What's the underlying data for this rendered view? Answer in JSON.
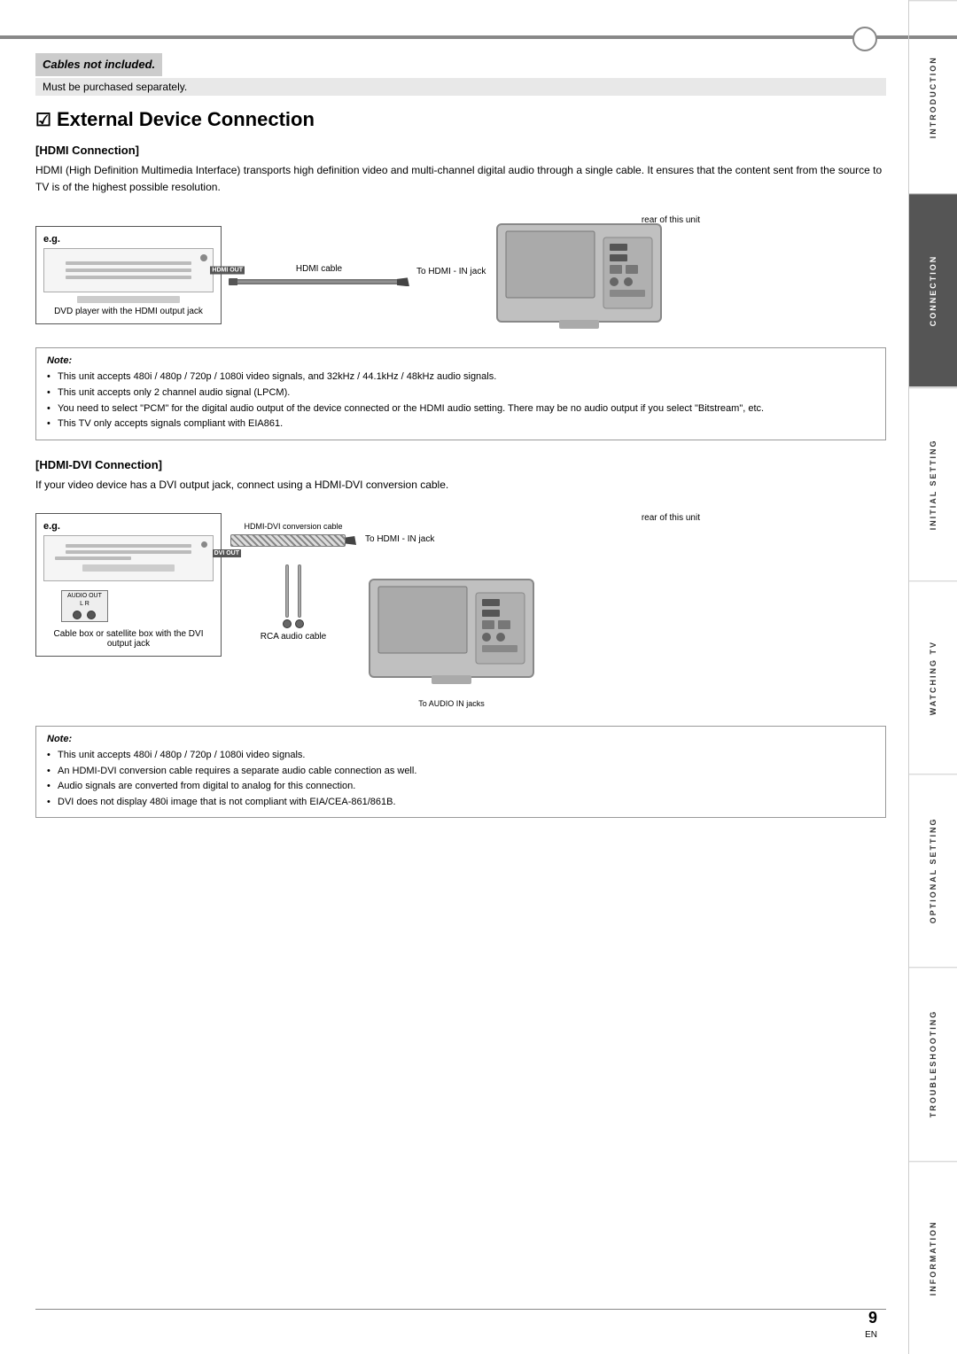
{
  "page": {
    "number": "9",
    "lang": "EN"
  },
  "cables_banner": {
    "bold_text": "Cables not included.",
    "sub_text": "Must be purchased separately."
  },
  "section_title": "External Device Connection",
  "hdmi_section": {
    "heading": "[HDMI Connection]",
    "description": "HDMI (High Definition Multimedia Interface) transports high definition video and multi-channel digital audio through a single cable. It ensures that the content sent from the source to TV is of the highest possible resolution.",
    "rear_label": "rear of this unit",
    "device_label": "DVD player with the HDMI output jack",
    "cable_label": "HDMI cable",
    "port_label": "To HDMI - IN jack",
    "hdmi_out": "HDMI OUT",
    "eg_label": "e.g."
  },
  "hdmi_note": {
    "title": "Note:",
    "items": [
      "This unit accepts 480i / 480p / 720p / 1080i video signals, and 32kHz / 44.1kHz / 48kHz audio signals.",
      "This unit accepts only 2 channel audio signal (LPCM).",
      "You need to select \"PCM\" for the digital audio output of the device connected or the HDMI audio setting. There may be no audio output if you select \"Bitstream\", etc.",
      "This TV only accepts signals compliant with EIA861."
    ]
  },
  "hdmi_dvi_section": {
    "heading": "[HDMI-DVI Connection]",
    "description": "If your video device has a DVI output jack, connect using a HDMI-DVI conversion cable.",
    "rear_label": "rear of this unit",
    "device_label": "Cable box or satellite box with the DVI output jack",
    "conversion_cable_label": "HDMI-DVI conversion cable",
    "port_label": "To HDMI - IN jack",
    "dvi_out": "DVI OUT",
    "audio_out": "AUDIO OUT",
    "lr_label": "L    R",
    "rca_label": "RCA audio cable",
    "to_audio_label": "To AUDIO IN jacks",
    "eg_label": "e.g."
  },
  "hdmi_dvi_note": {
    "title": "Note:",
    "items": [
      "This unit accepts 480i / 480p / 720p / 1080i video signals.",
      "An HDMI-DVI conversion cable requires a separate audio cable connection as well.",
      "Audio signals are converted from digital to analog for this connection.",
      "DVI does not display 480i image that is not compliant with EIA/CEA-861/861B."
    ]
  },
  "sidebar": {
    "tabs": [
      {
        "label": "INTRODUCTION",
        "active": false
      },
      {
        "label": "CONNECTION",
        "active": true
      },
      {
        "label": "INITIAL SETTING",
        "active": false
      },
      {
        "label": "WATCHING TV",
        "active": false
      },
      {
        "label": "OPTIONAL SETTING",
        "active": false
      },
      {
        "label": "TROUBLESHOOTING",
        "active": false
      },
      {
        "label": "INFORMATION",
        "active": false
      }
    ]
  }
}
